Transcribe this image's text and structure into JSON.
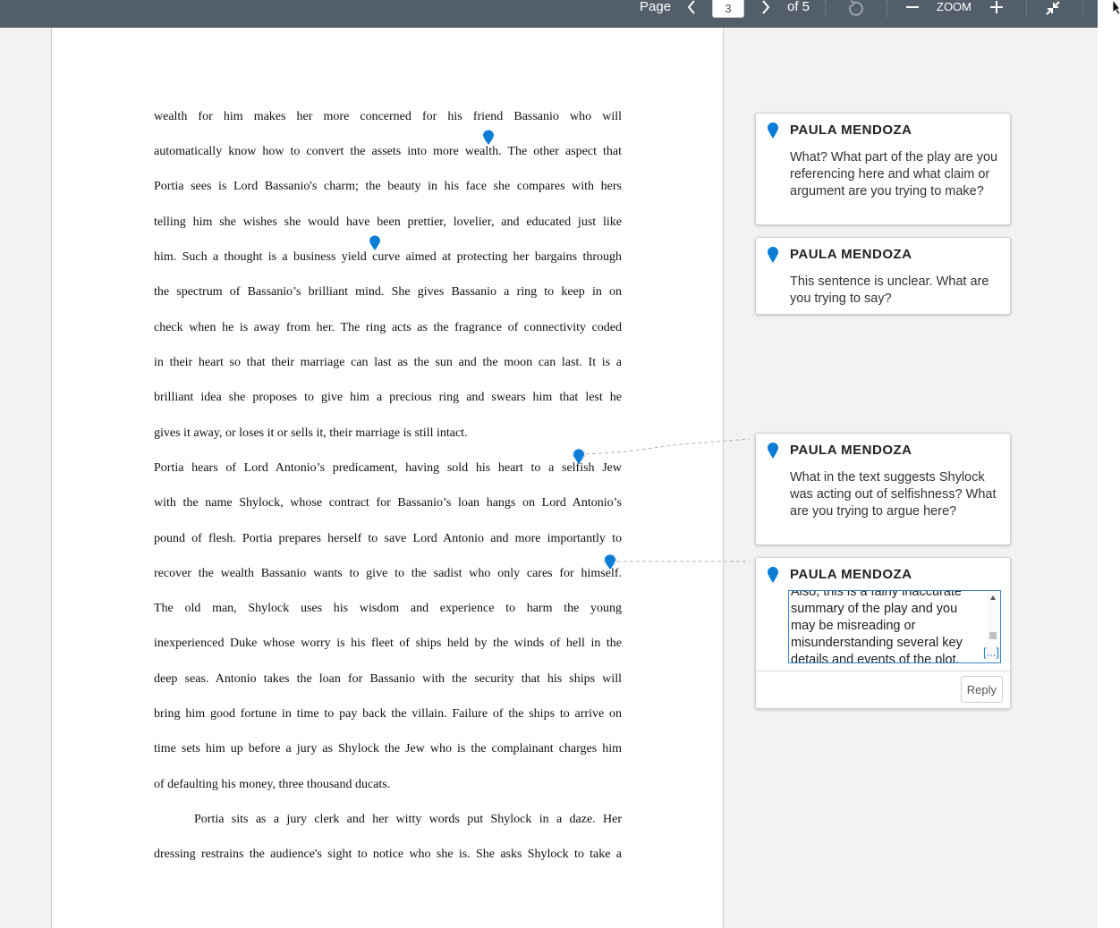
{
  "toolbar": {
    "page_label": "Page",
    "current_page": "3",
    "of_label": "of 5",
    "zoom_label": "ZOOM",
    "icons": [
      "chevron-left-icon",
      "chevron-right-icon",
      "rotate-icon",
      "zoom-out-icon",
      "zoom-in-icon",
      "collapse-icon",
      "cursor-icon"
    ]
  },
  "document": {
    "lines": [
      "wealth for him makes her more concerned for his friend Bassanio who will",
      "automatically know how to convert the assets into more wealth. The other aspect that",
      "Portia sees is Lord Bassanio's charm; the beauty in his face she compares with hers",
      "telling him she wishes she would have been prettier, lovelier, and educated just like",
      "him. Such a thought is a business yield curve aimed at protecting her bargains through",
      "the spectrum of Bassanio’s brilliant mind. She gives Bassanio a ring to keep in on",
      "check when he is away from her. The ring acts as the fragrance of connectivity coded",
      "in their heart so that their marriage can last as the sun and the moon can last. It is a",
      "brilliant idea she proposes to give him a precious ring and swears him that lest he",
      "gives it away, or loses it or sells it, their marriage is still intact.",
      "Portia hears of Lord Antonio’s predicament, having sold his heart to a selfish Jew",
      "with the name Shylock, whose contract for Bassanio’s loan hangs on Lord Antonio’s",
      "pound of flesh. Portia prepares herself to save Lord Antonio and more importantly to",
      "recover the wealth Bassanio wants to give to the sadist who only cares for himself.",
      "The old man, Shylock uses his wisdom and experience to harm the young",
      "inexperienced Duke whose worry is his fleet of ships held by the winds of hell in the",
      "deep seas. Antonio takes the loan for Bassanio with the security that his ships will",
      "bring him good fortune in time to pay back the villain. Failure of the ships to arrive on",
      "time sets him up before a jury as Shylock the Jew who is the complainant charges him",
      "of defaulting his money, three thousand ducats.",
      "Portia sits as a jury clerk and her witty words put Shylock in a daze. Her",
      "dressing restrains the audience's sight to notice who she is. She asks Shylock to take a"
    ]
  },
  "comments": [
    {
      "author": "PAULA MENDOZA",
      "text": "What? What part of the play are you referencing here and what claim or argument are you trying to make?"
    },
    {
      "author": "PAULA MENDOZA",
      "text": "This sentence is unclear. What are you trying to say?"
    },
    {
      "author": "PAULA MENDOZA",
      "text": "What in the text suggests Shylock was acting out of selfishness? What are you trying to argue here?"
    },
    {
      "author": "PAULA MENDOZA",
      "text": "Also, this is a fairly inaccurate summary of the play and you may be misreading or misunderstanding several key details and events of the plot.",
      "more": "[...]",
      "reply": "Reply"
    }
  ],
  "colors": {
    "toolbar": "#525f6b",
    "pin": "#0b7dd6",
    "link": "#2a7bd1"
  }
}
